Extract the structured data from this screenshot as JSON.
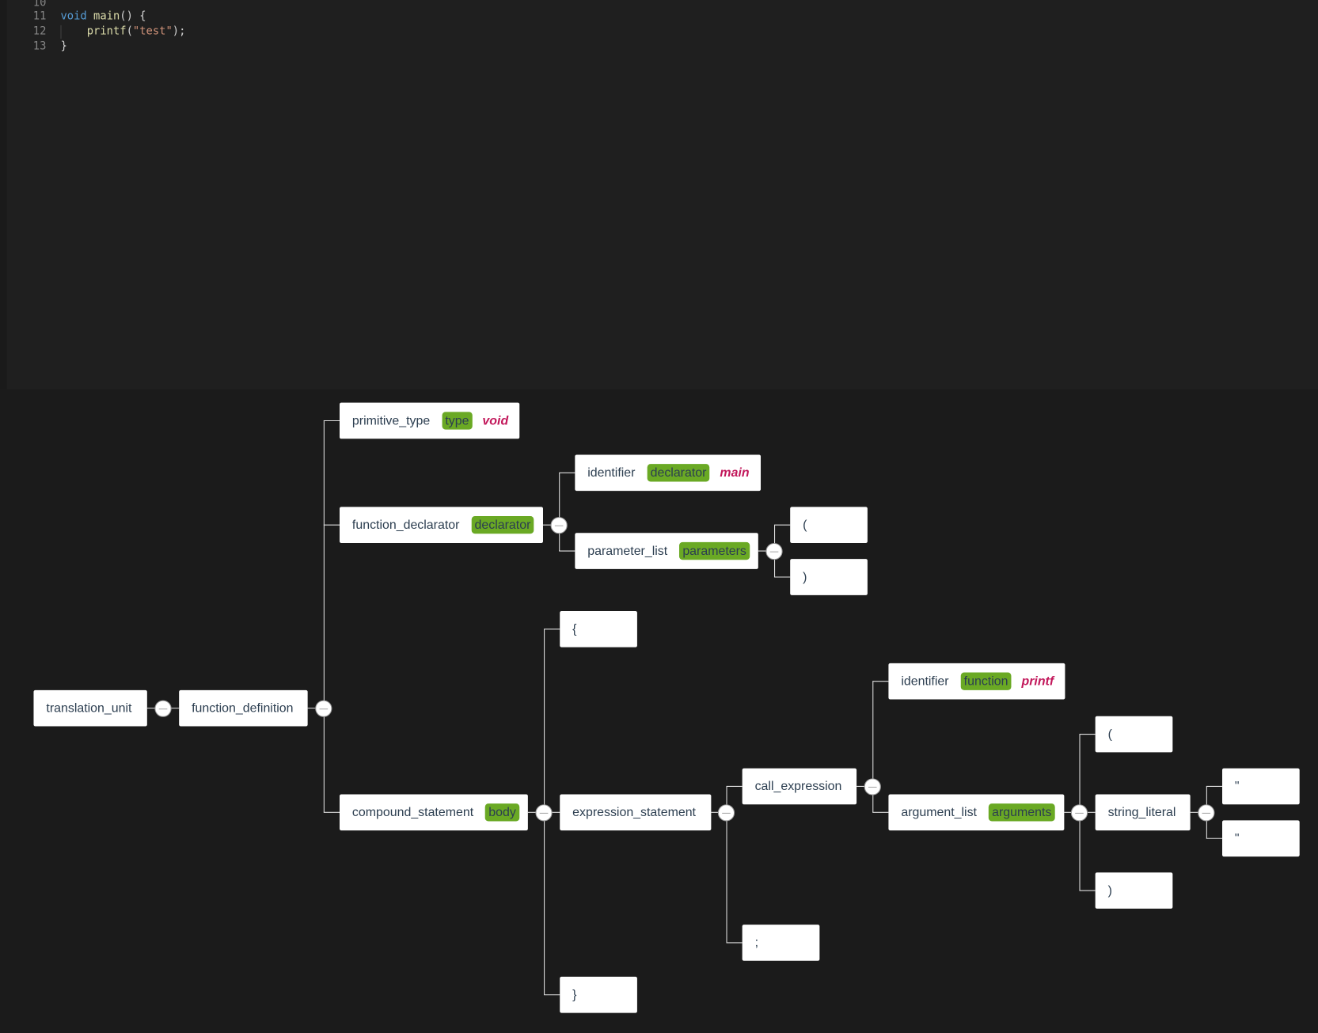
{
  "editor": {
    "lines": [
      {
        "num": "10",
        "code": ""
      },
      {
        "num": "11",
        "code": "void main() {"
      },
      {
        "num": "12",
        "code": "    printf(\"test\");"
      },
      {
        "num": "13",
        "code": "}"
      }
    ]
  },
  "tree": {
    "nodes": [
      {
        "type": "translation_unit"
      },
      {
        "type": "function_definition"
      },
      {
        "type": "primitive_type",
        "field": "type",
        "value": "void"
      },
      {
        "type": "function_declarator",
        "field": "declarator"
      },
      {
        "type": "identifier",
        "field": "declarator",
        "value": "main"
      },
      {
        "type": "parameter_list",
        "field": "parameters"
      },
      {
        "type": "("
      },
      {
        "type": ")"
      },
      {
        "type": "compound_statement",
        "field": "body"
      },
      {
        "type": "{"
      },
      {
        "type": "expression_statement"
      },
      {
        "type": "}"
      },
      {
        "type": "call_expression"
      },
      {
        "type": ";"
      },
      {
        "type": "identifier",
        "field": "function",
        "value": "printf"
      },
      {
        "type": "argument_list",
        "field": "arguments"
      },
      {
        "type": "("
      },
      {
        "type": "string_literal"
      },
      {
        "type": ")"
      },
      {
        "type": "\""
      },
      {
        "type": "\""
      }
    ]
  }
}
